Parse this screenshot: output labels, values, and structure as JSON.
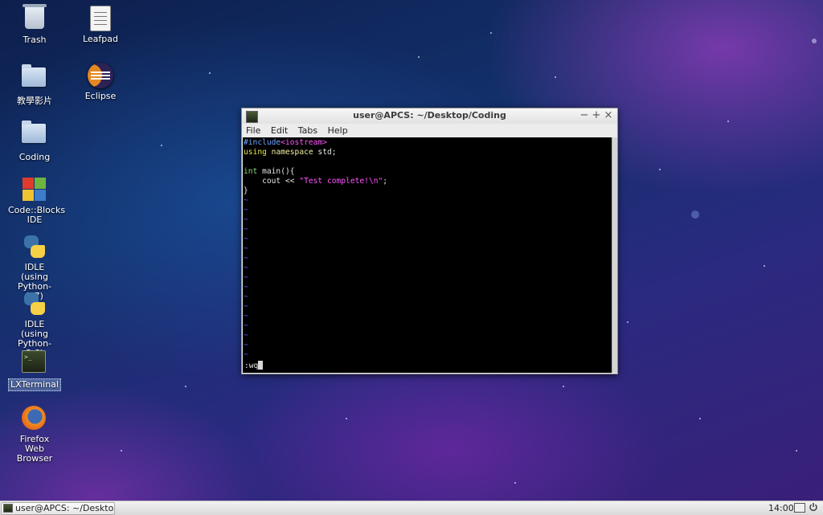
{
  "desktop": {
    "icons": [
      {
        "label": "Trash"
      },
      {
        "label": "Leafpad"
      },
      {
        "label": "教學影片"
      },
      {
        "label": "Eclipse"
      },
      {
        "label": "Coding"
      },
      {
        "label": "Code::Blocks IDE"
      },
      {
        "label": "IDLE (using Python-2.7)"
      },
      {
        "label": "IDLE (using Python-3.6)"
      },
      {
        "label": "LXTerminal",
        "selected": true
      },
      {
        "label": "Firefox Web Browser"
      }
    ]
  },
  "window": {
    "title": "user@APCS: ~/Desktop/Coding",
    "controls": {
      "minimize": "−",
      "maximize": "+",
      "close": "×"
    },
    "menu": [
      "File",
      "Edit",
      "Tabs",
      "Help"
    ]
  },
  "editor": {
    "include_directive": "#include",
    "include_header": "<iostream>",
    "using_kw": "using",
    "namespace_kw": "namespace",
    "namespace_rest": " std;",
    "int_kw": "int",
    "main_sig": " main(){",
    "cout_prefix": "    cout << ",
    "cout_string": "\"Test complete!\\n\"",
    "cout_suffix": ";",
    "closing_brace": "}",
    "tilde": "~",
    "command_line": ":wq"
  },
  "taskbar": {
    "task_label": "user@APCS: ~/Deskto...",
    "clock": "14:00"
  },
  "colors": {
    "preprocessor": "#6fa6ff",
    "string": "#ff55ff",
    "keyword": "#e5e54a",
    "type": "#8cd47a",
    "tilde": "#5a5aff",
    "terminal_bg": "#000000"
  }
}
